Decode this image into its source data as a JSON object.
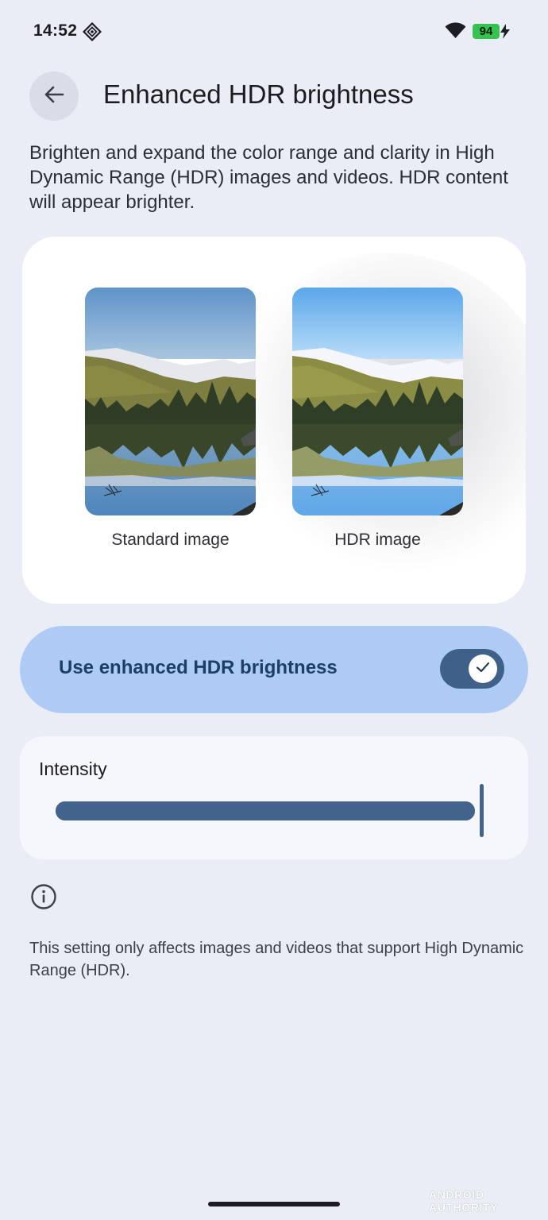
{
  "status_bar": {
    "time": "14:52",
    "battery_level": "94",
    "icons": [
      "notification-diamond-icon",
      "wifi-icon",
      "charging-bolt-icon"
    ]
  },
  "header": {
    "title": "Enhanced HDR brightness",
    "back_icon": "arrow-back-icon"
  },
  "description": "Brighten and expand the color range and clarity in High Dynamic Range (HDR) images and videos. HDR content will appear brighter.",
  "preview": {
    "standard_caption": "Standard image",
    "hdr_caption": "HDR image"
  },
  "toggle": {
    "label": "Use enhanced HDR brightness",
    "checked": true,
    "accent_color": "#aecbf5"
  },
  "intensity": {
    "label": "Intensity",
    "value_percent": 100
  },
  "info": {
    "icon": "info-icon",
    "text": "This setting only affects images and videos that support High Dynamic Range (HDR)."
  },
  "watermark": "ANDROID AUTHORITY"
}
